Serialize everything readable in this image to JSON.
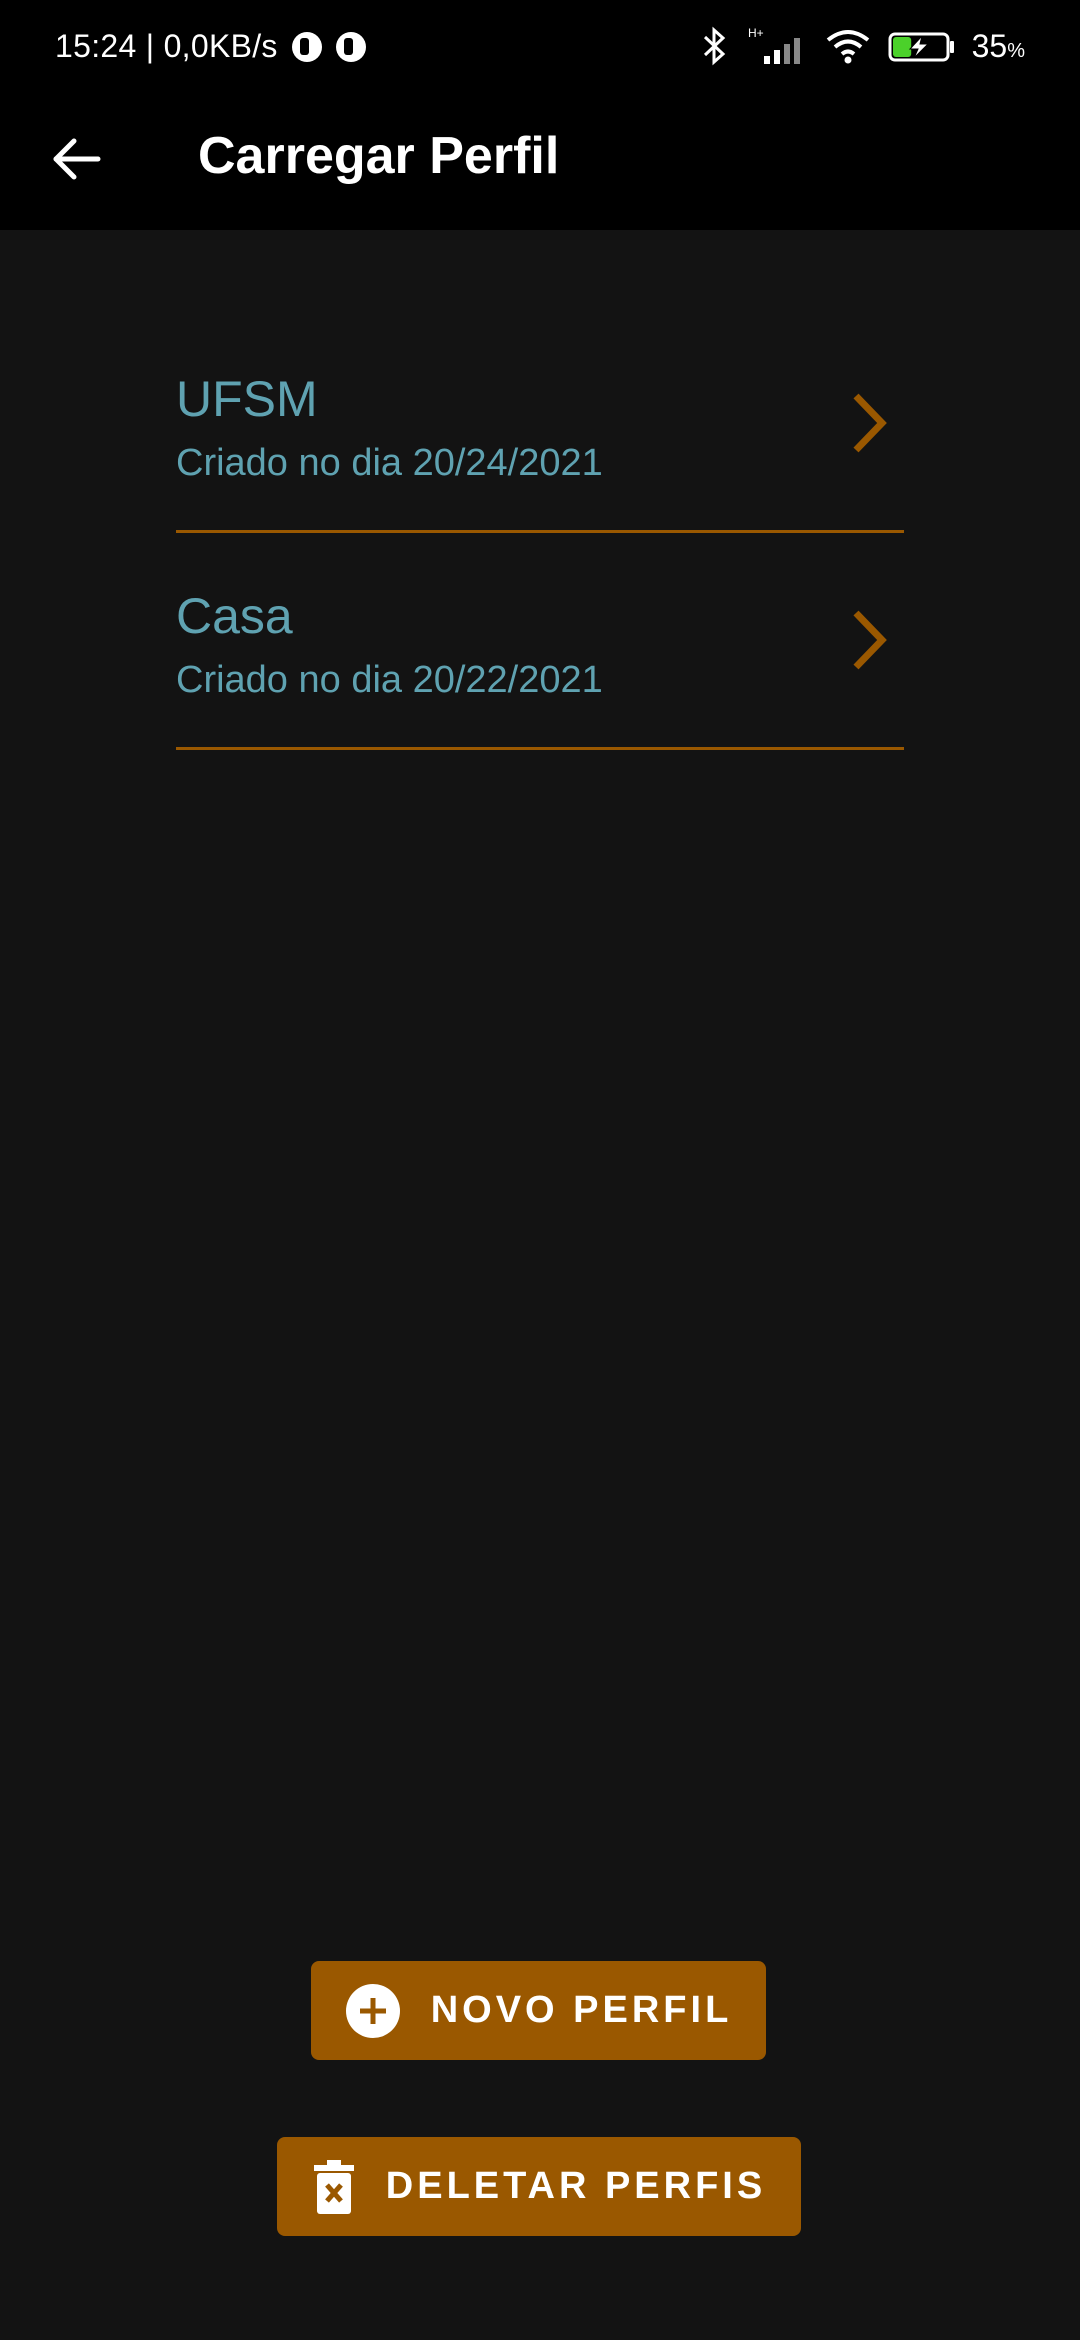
{
  "status_bar": {
    "left_text": "15:24 | 0,0KB/s",
    "network_label": "H+",
    "battery_percent": "35",
    "percent_sign": "%",
    "battery_level": 0.35
  },
  "app_bar": {
    "title": "Carregar Perfil",
    "back_icon": "arrow-left-icon"
  },
  "profiles": [
    {
      "name": "UFSM",
      "created": "Criado no dia 20/24/2021"
    },
    {
      "name": "Casa",
      "created": "Criado no dia 20/22/2021"
    }
  ],
  "buttons": {
    "new_profile": "NOVO PERFIL",
    "delete_profiles": "DELETAR PERFIS"
  },
  "colors": {
    "background": "#131313",
    "bar": "#000000",
    "accent": "#9a5800",
    "text_teal": "#5fa2b1",
    "battery_green": "#4bd12a"
  }
}
